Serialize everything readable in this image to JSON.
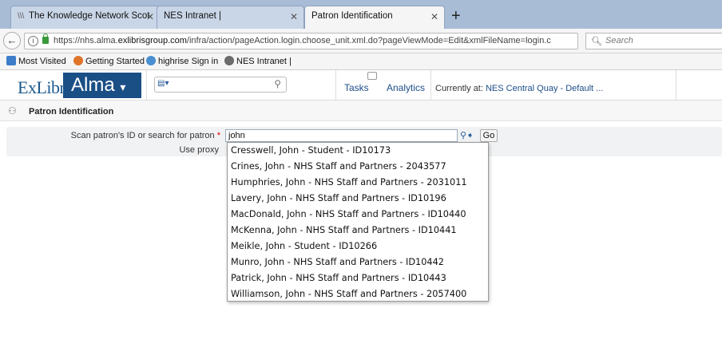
{
  "browser": {
    "tabs": [
      {
        "label": "The Knowledge Network Scot"
      },
      {
        "label": "NES Intranet |"
      },
      {
        "label": "Patron Identification"
      }
    ],
    "url": {
      "prefix": "https://nhs.alma.",
      "domain": "exlibrisgroup.com",
      "path": "/infra/action/pageAction.login.choose_unit.xml.do?pageViewMode=Edit&xmlFileName=login.c"
    },
    "search_placeholder": "Search",
    "bookmarks": [
      {
        "label": "Most Visited",
        "color": "#3d7cc9"
      },
      {
        "label": "Getting Started",
        "color": "#e0742a"
      },
      {
        "label": "highrise Sign in",
        "color": "#4a8fd1"
      },
      {
        "label": "NES Intranet |",
        "color": "#6b6b6b"
      }
    ]
  },
  "app": {
    "logo_text": "ExLibris",
    "product_name": "Alma",
    "nav": {
      "tasks": "Tasks",
      "analytics": "Analytics"
    },
    "current_location": {
      "label": "Currently at:",
      "value": "NES Central Quay - Default ..."
    }
  },
  "page": {
    "title": "Patron Identification",
    "form": {
      "scan_label": "Scan patron's ID or search for patron",
      "required_marker": "*",
      "scan_value": "john",
      "go_label": "Go",
      "proxy_label": "Use proxy"
    },
    "suggestions": [
      "Cresswell, John - Student - ID10173",
      "Crines, John - NHS Staff and Partners - 2043577",
      "Humphries, John - NHS Staff and Partners - 2031011",
      "Lavery, John - NHS Staff and Partners - ID10196",
      "MacDonald, John - NHS Staff and Partners - ID10440",
      "McKenna, John - NHS Staff and Partners - ID10441",
      "Meikle, John - Student - ID10266",
      "Munro, John - NHS Staff and Partners - ID10442",
      "Patrick, John - NHS Staff and Partners - ID10443",
      "Williamson, John - NHS Staff and Partners - 2057400"
    ]
  }
}
